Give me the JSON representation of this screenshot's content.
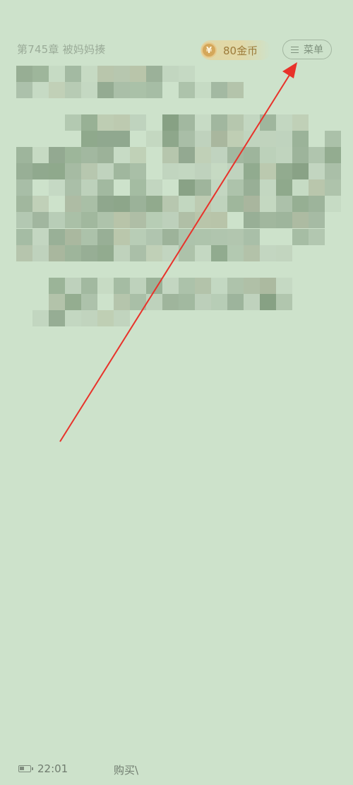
{
  "header": {
    "chapter_title": "第745章 被妈妈揍",
    "coins_label": "80金币",
    "coin_icon_glyph": "¥",
    "menu_label": "菜单",
    "menu_icon": "hamburger-icon"
  },
  "content": {
    "text_state": "pixelated"
  },
  "status_bar": {
    "time": "22:01",
    "bottom_text": "购买\\"
  },
  "annotation": {
    "color": "#e8322a"
  },
  "colors": {
    "background": "#cde2cb",
    "coin_text": "#9c7b3a",
    "menu_text": "#7f927e"
  }
}
